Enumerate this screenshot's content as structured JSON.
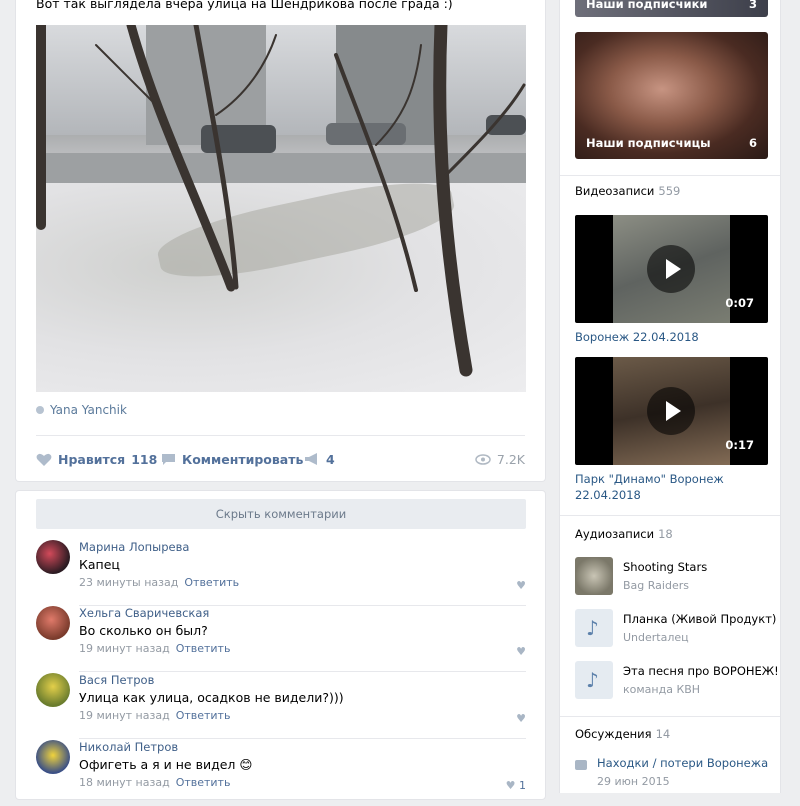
{
  "post": {
    "text": "Вот так выглядела вчера улица на Шендрикова после града :)",
    "author": "Yana Yanchik",
    "likes_label": "Нравится",
    "likes_count": "118",
    "comment_label": "Комментировать",
    "reposts_count": "4",
    "views": "7.2K"
  },
  "comments": {
    "hide_label": "Скрыть комментарии",
    "reply_label": "Ответить",
    "items": [
      {
        "name": "Марина Лопырева",
        "text": "Капец",
        "time": "23 минуты назад",
        "likes": ""
      },
      {
        "name": "Хельга Сваричевская",
        "text": "Во сколько он был?",
        "time": "19 минут назад",
        "likes": ""
      },
      {
        "name": "Вася Петров",
        "text": "Улица как улица, осадков не видели?)))",
        "time": "19 минут назад",
        "likes": ""
      },
      {
        "name": "Николай Петров",
        "text": "Офигеть а я и не видел 😊",
        "time": "18 минут назад",
        "likes": "1"
      }
    ]
  },
  "sidebar": {
    "albums": [
      {
        "label": "Наши подписчики",
        "count": "3"
      },
      {
        "label": "Наши подписчицы",
        "count": "6"
      }
    ],
    "videos_title": "Видеозаписи",
    "videos_count": "559",
    "videos": [
      {
        "title": "Воронеж 22.04.2018",
        "duration": "0:07"
      },
      {
        "title": "Парк \"Динамо\" Воронеж 22.04.2018",
        "duration": "0:17"
      }
    ],
    "audio_title": "Аудиозаписи",
    "audio_count": "18",
    "audio": [
      {
        "title": "Shooting Stars",
        "artist": "Bag Raiders"
      },
      {
        "title": "Планка (Живой Продукт)",
        "artist": "Undertaлец"
      },
      {
        "title": "Эта песня про ВОРОНЕЖ!",
        "artist": "команда КВН"
      }
    ],
    "discussions_title": "Обсуждения",
    "discussions_count": "14",
    "discussion": {
      "title": "Находки / потери Воронежа",
      "date": "29 июн 2015"
    }
  }
}
